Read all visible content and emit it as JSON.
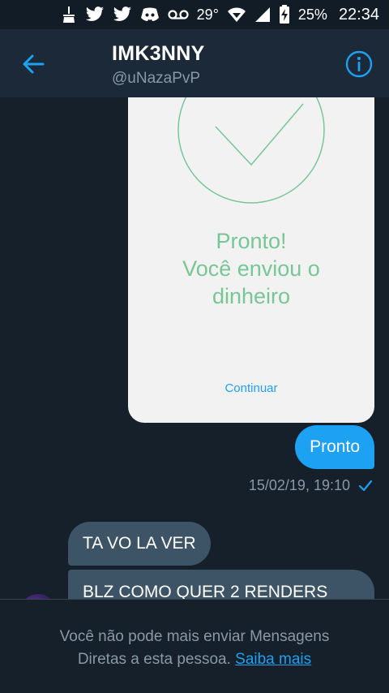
{
  "status_bar": {
    "temperature": "29°",
    "battery": "25%",
    "time": "22:34",
    "icons": [
      "broom-icon",
      "twitter-icon",
      "twitter-icon",
      "discord-icon",
      "voicemail-icon",
      "wifi-icon",
      "signal-icon",
      "battery-charging-icon"
    ]
  },
  "header": {
    "name": "IMK3NNY",
    "handle": "@uNazaPvP"
  },
  "card": {
    "message_lines": [
      "Pronto!",
      "Você enviou o",
      "dinheiro"
    ],
    "continue_label": "Continuar"
  },
  "messages": {
    "sent_text": "Pronto",
    "sent_timestamp": "15/02/19, 19:10",
    "received_1": "TA VO LA VER",
    "received_2": "BLZ COMO QUER 2 RENDERS"
  },
  "footer": {
    "line1": "Você não pode mais enviar Mensagens",
    "line2": "Diretas a esta pessoa.",
    "link": "Saiba mais"
  },
  "colors": {
    "background": "#15202b",
    "header": "#1c2938",
    "accent": "#1da1f2",
    "received_bubble": "#3d5466",
    "card_green": "#77c796",
    "muted_text": "#8899a6"
  }
}
